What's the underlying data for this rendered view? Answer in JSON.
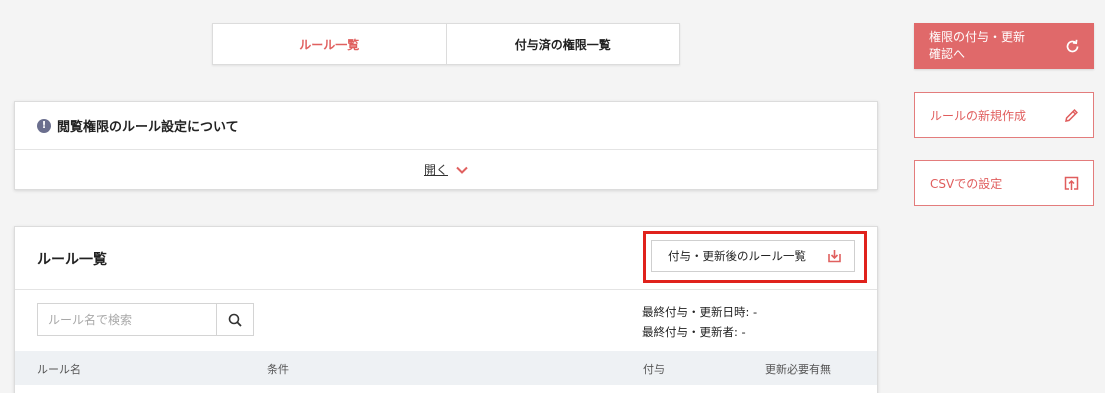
{
  "tabs": [
    {
      "label": "ルール一覧",
      "active": true
    },
    {
      "label": "付与済の権限一覧",
      "active": false
    }
  ],
  "info": {
    "title": "閲覧権限のルール設定について",
    "icon": "exclamation-circle-icon",
    "toggle_label": "開く"
  },
  "rule_list": {
    "title": "ルール一覧",
    "download_label": "付与・更新後のルール一覧",
    "search_placeholder": "ルール名で検索",
    "last_granted_at": "最終付与・更新日時: -",
    "last_granted_by": "最終付与・更新者: -",
    "columns": [
      "ルール名",
      "条件",
      "付与",
      "更新必要有無"
    ]
  },
  "actions": {
    "grant_update_line1": "権限の付与・更新",
    "grant_update_line2": "確認へ",
    "new_rule": "ルールの新規作成",
    "csv": "CSVでの設定"
  },
  "colors": {
    "accent": "#e0605f",
    "highlight": "#e0221c",
    "table_header_bg": "#eef1f4"
  }
}
